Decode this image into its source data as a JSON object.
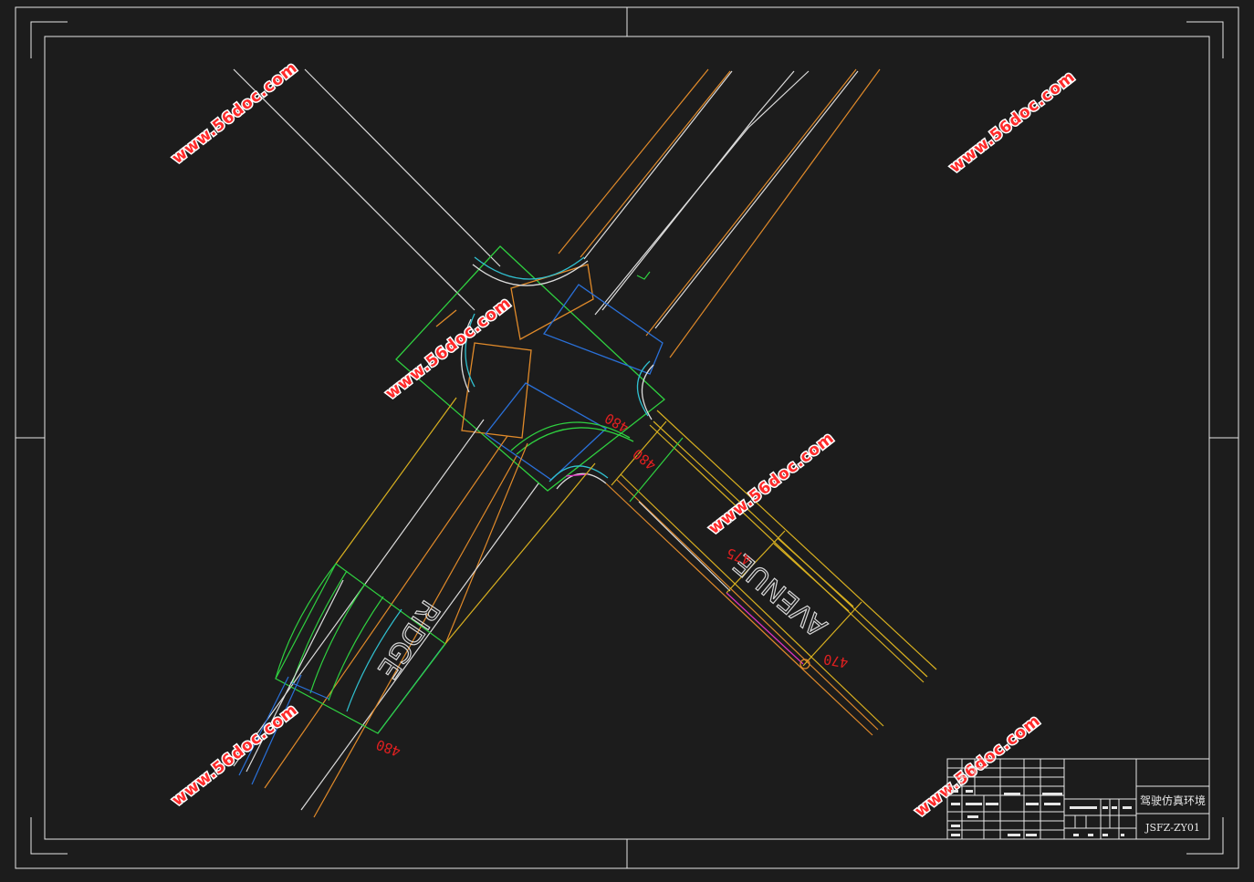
{
  "watermarks": [
    {
      "text": "www.56doc.com"
    },
    {
      "text": "www.56doc.com"
    },
    {
      "text": "www.56doc.com"
    },
    {
      "text": "www.56doc.com"
    },
    {
      "text": "www.56doc.com"
    },
    {
      "text": "www.56doc.com"
    }
  ],
  "dimension_labels": {
    "d1": "480",
    "d2": "480",
    "d3": "475",
    "d4": "470",
    "d5": "480"
  },
  "road_labels": {
    "avenue": "AVENUE",
    "ridge": "RIDGE"
  },
  "title_block": {
    "drawing_title": "驾驶仿真环境",
    "drawing_number": "JSFZ-ZY01"
  },
  "colors": {
    "background": "#1c1c1c",
    "frame": "#e6e6e6",
    "road_white": "#dcdcdc",
    "orange": "#e08a2a",
    "yellow": "#d8b020",
    "green": "#2fd040",
    "blue": "#2a70d8",
    "cyan": "#30c0d0",
    "magenta": "#e030c0",
    "dim_red": "#e02020",
    "watermark_red": "#ff2a2a"
  }
}
